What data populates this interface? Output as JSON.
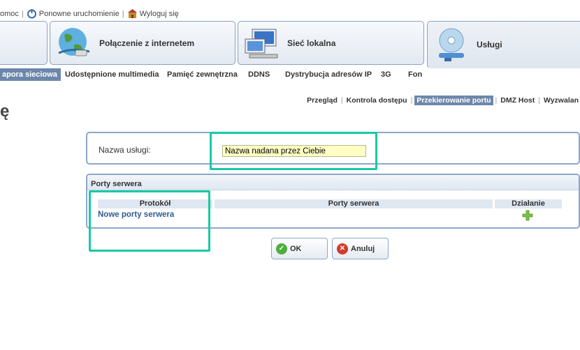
{
  "top_links": {
    "help": "omoc",
    "restart": "Ponowne uruchomienie",
    "logout": "Wyloguj się"
  },
  "main_tabs": {
    "internet": "Połączenie z internetem",
    "lan": "Sieć lokalna",
    "services": "Usługi"
  },
  "sub_nav": {
    "firewall": "apora sieciowa",
    "media": "Udostępnione multimedia",
    "storage": "Pamięć zewnętrzna",
    "ddns": "DDNS",
    "dhcp": "Dystrybucja adresów IP",
    "g3": "3G",
    "fon": "Fon"
  },
  "third_nav": {
    "overview": "Przegląd",
    "access": "Kontrola dostępu",
    "forwarding": "Przekierowanie portu",
    "dmz": "DMZ Host",
    "trigger": "Wyzwalan"
  },
  "page_title_fragment": "ę",
  "service_form": {
    "name_label": "Nazwa usługi:",
    "name_value": "Nazwa nadana przez Ciebie"
  },
  "ports_panel": {
    "title": "Porty serwera",
    "columns": [
      "Protokół",
      "Porty serwera",
      "Działanie"
    ],
    "new_ports_link": "Nowe porty serwera"
  },
  "buttons": {
    "ok": "OK",
    "cancel": "Anuluj"
  },
  "colors": {
    "highlight": "#19c9a4",
    "nav_active": "#6d87ab",
    "link": "#2e5c94",
    "input_bg": "#ffffc4"
  }
}
